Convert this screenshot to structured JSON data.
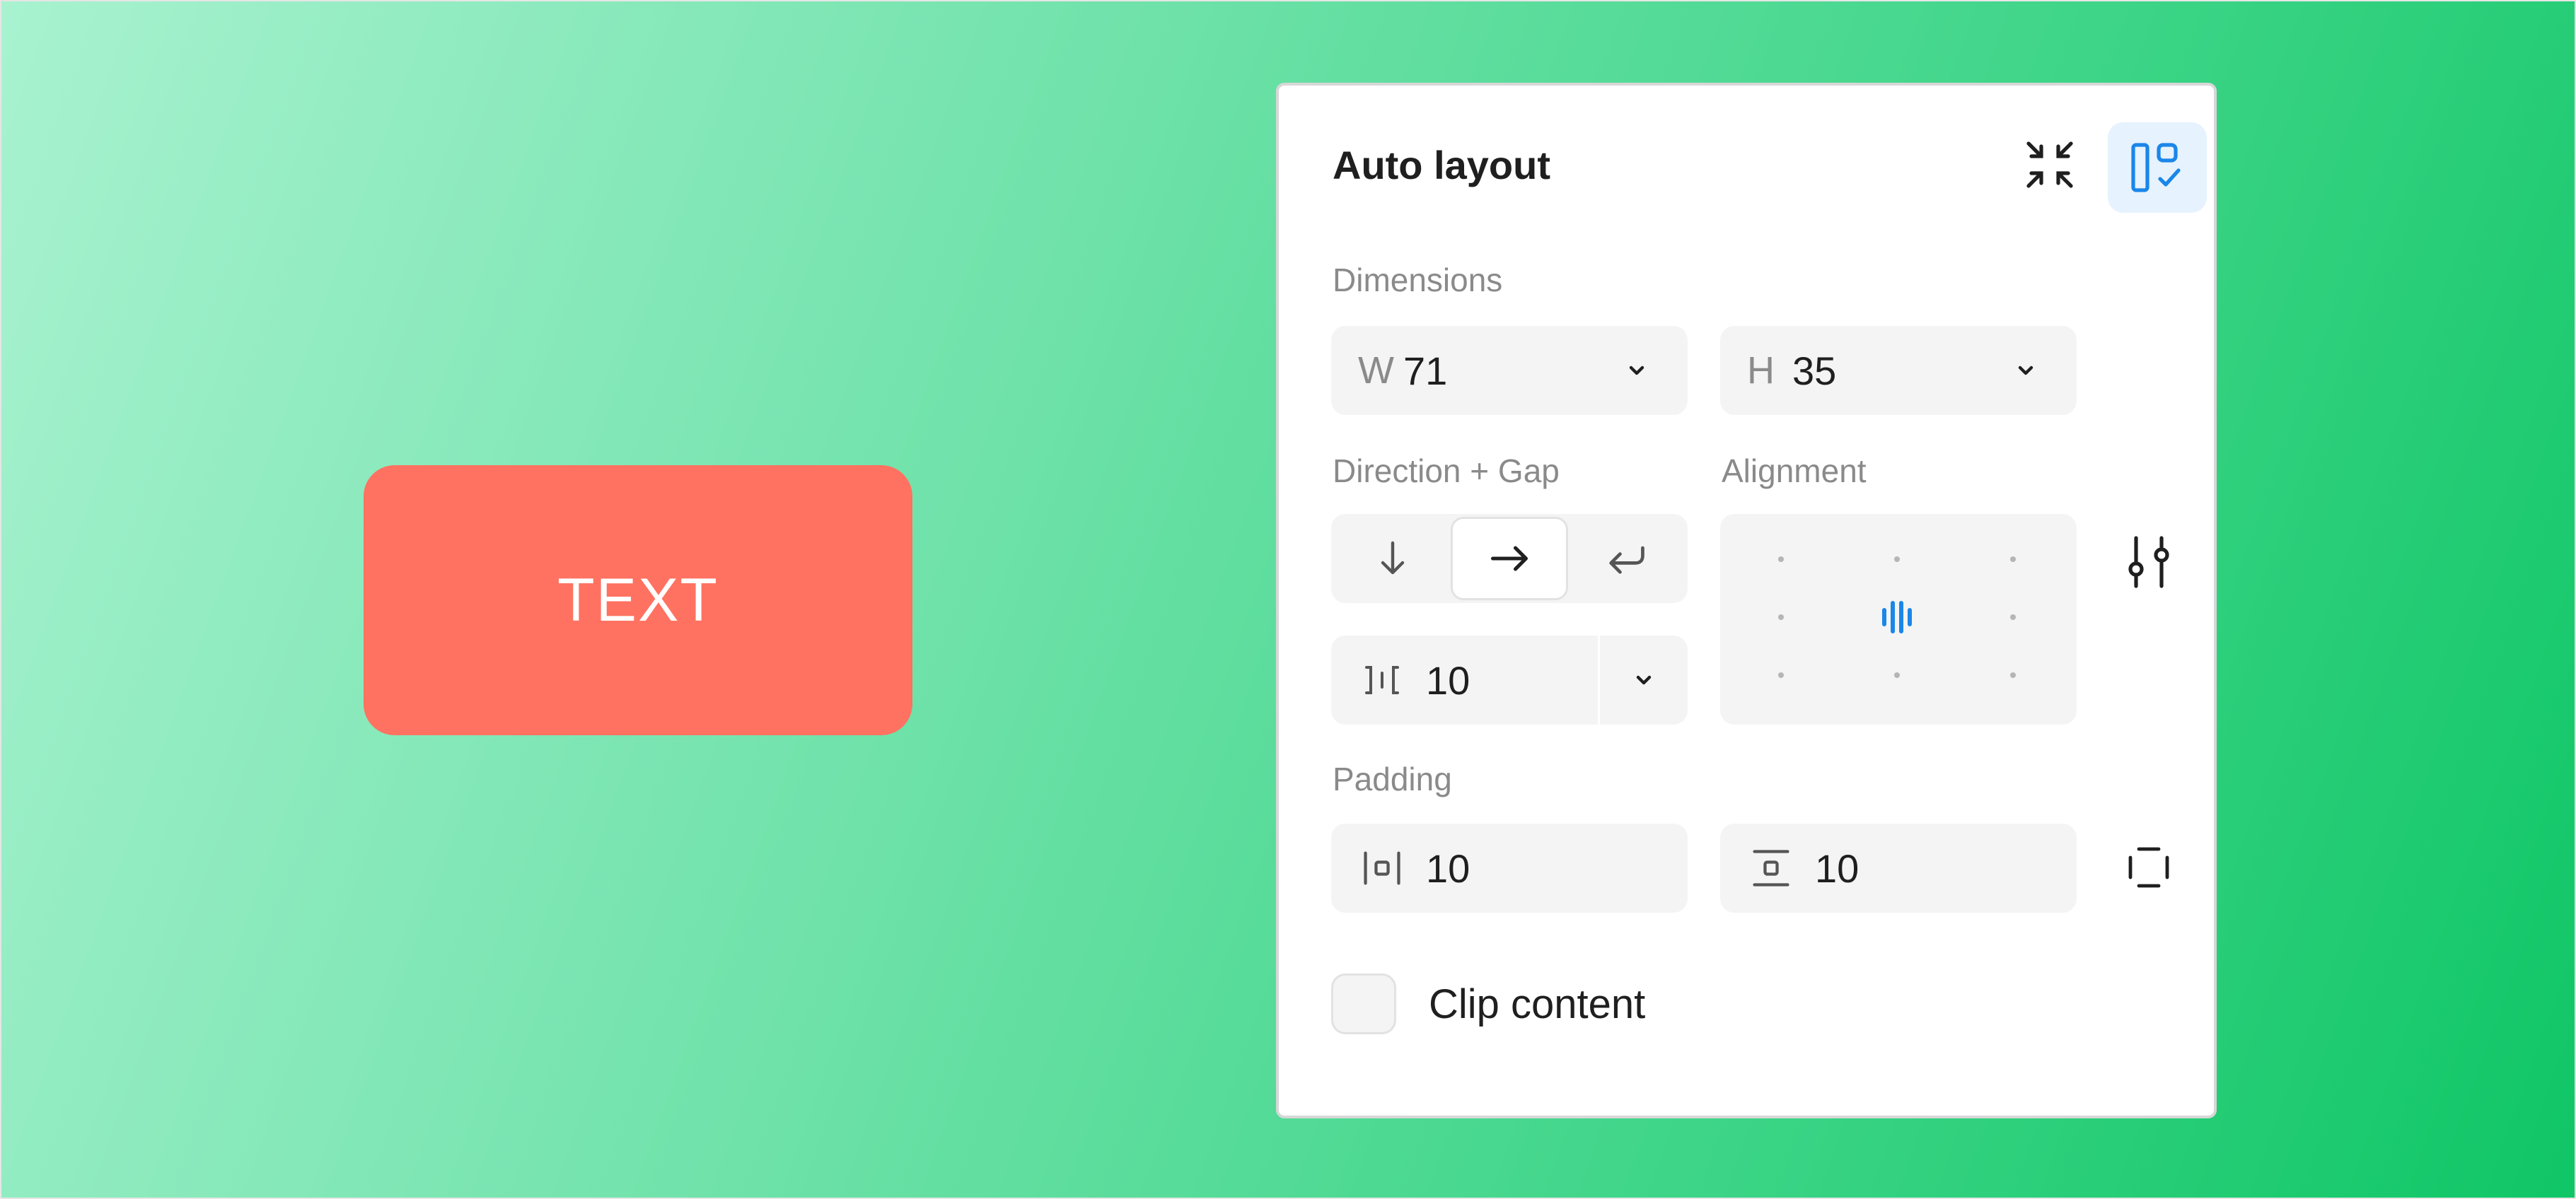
{
  "canvas": {
    "frame_text": "TEXT",
    "frame_color": "#ff7261"
  },
  "panel": {
    "title": "Auto layout",
    "collapse_icon": "collapse-arrows-icon",
    "layout_icon": "layout-check-icon",
    "accent": "#1a86e8",
    "dimensions": {
      "label": "Dimensions",
      "width_prefix": "W",
      "width_value": "71",
      "height_prefix": "H",
      "height_value": "35"
    },
    "direction": {
      "label": "Direction + Gap",
      "options": [
        "vertical",
        "horizontal",
        "wrap"
      ],
      "selected": "horizontal",
      "gap_value": "10"
    },
    "alignment": {
      "label": "Alignment",
      "selected": "center"
    },
    "padding": {
      "label": "Padding",
      "horizontal_value": "10",
      "vertical_value": "10"
    },
    "clip": {
      "label": "Clip content",
      "checked": false
    }
  }
}
